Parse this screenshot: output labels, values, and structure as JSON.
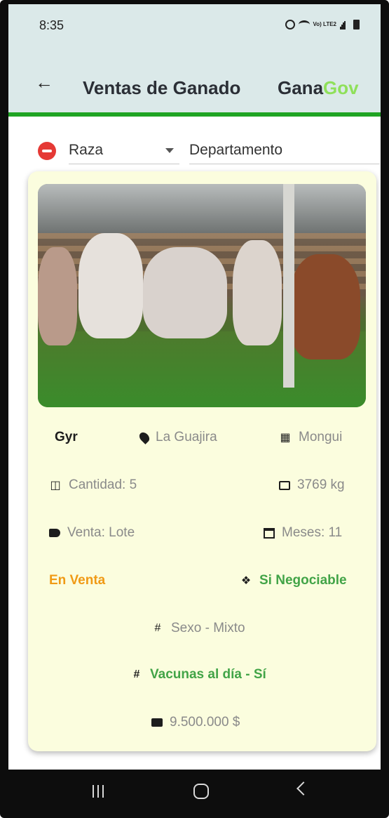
{
  "status_bar": {
    "time": "8:35",
    "icons": [
      "alarm-icon",
      "wifi-icon",
      "lte-icon",
      "signal-icon",
      "battery-icon"
    ],
    "lte_label": "Vo) LTE2"
  },
  "app_bar": {
    "title": "Ventas de Ganado",
    "brand_part1": "Gana",
    "brand_part2": "Gov",
    "brand_colors": {
      "part1": "#2b2f36",
      "part2": "#8fe05a"
    },
    "accent": "#1fa423"
  },
  "filters": {
    "raza_label": "Raza",
    "departamento_label": "Departamento"
  },
  "listing": {
    "breed": "Gyr",
    "department": "La Guajira",
    "municipality": "Mongui",
    "quantity": "Cantidad: 5",
    "weight": "3769 kg",
    "sale_type": "Venta: Lote",
    "months": "Meses: 11",
    "status": "En Venta",
    "negotiable": "Si Negociable",
    "sex": "Sexo - Mixto",
    "vaccines": "Vacunas al día - Sí",
    "price": "9.500.000 $"
  },
  "colors": {
    "status_orange": "#f09a15",
    "positive_green": "#42a447",
    "card_bg": "#fbfdde"
  },
  "nav_bar": {
    "buttons": [
      "recent-apps",
      "home",
      "back"
    ]
  }
}
